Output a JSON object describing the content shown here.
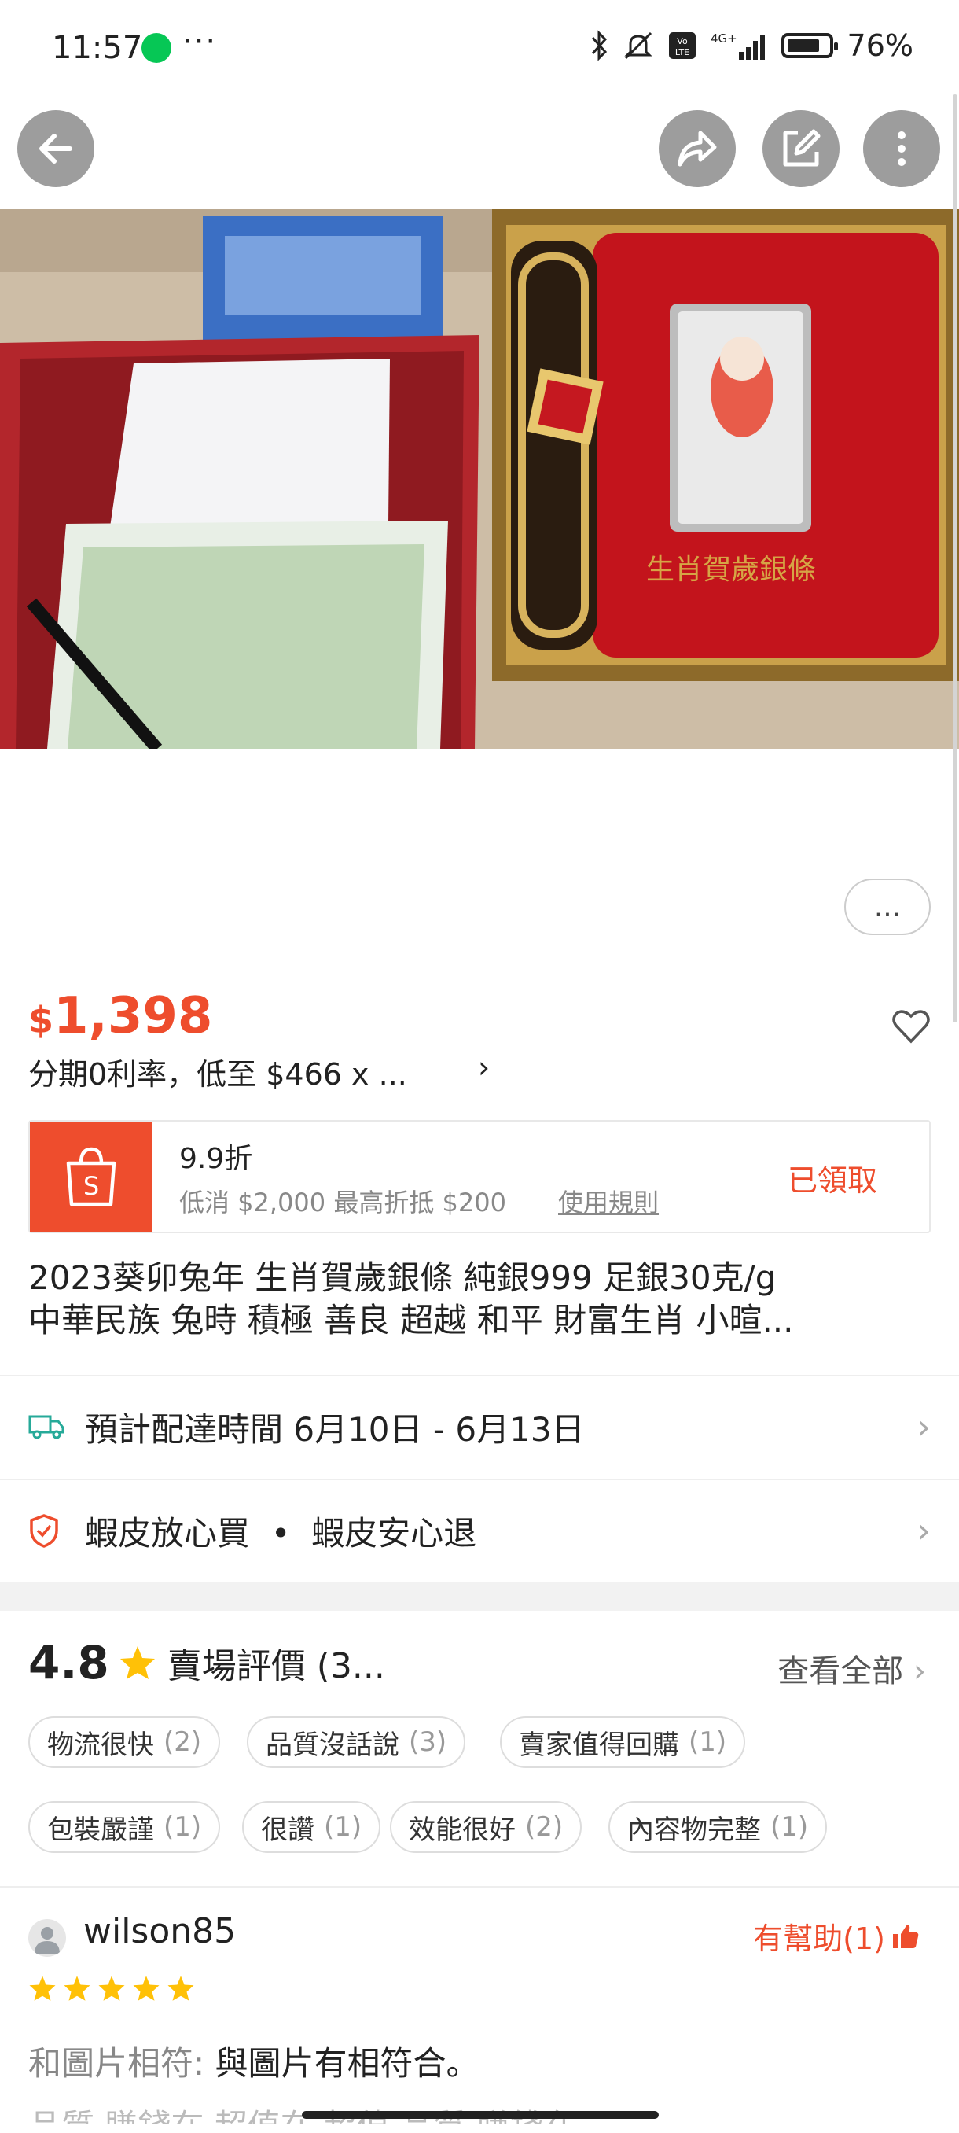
{
  "status_bar": {
    "time": "11:57",
    "more": "···",
    "battery": "76%",
    "icons": [
      "line-icon",
      "bluetooth-icon",
      "mute-icon",
      "volte-icon",
      "signal-icon",
      "battery-icon"
    ]
  },
  "nav": {
    "icons": [
      "back-arrow-icon",
      "share-icon",
      "edit-icon",
      "more-vertical-icon"
    ]
  },
  "product": {
    "gallery_more": "...",
    "price_currency": "$",
    "price_value": "1,398",
    "installment": "分期0利率，低至 $466 x ...",
    "installment_arrow": "›",
    "title_line1": "2023葵卯兔年 生肖賀歲銀條 純銀999 足銀30克/g",
    "title_line2": "中華民族 兔時 積極 善良 超越 和平 財富生肖 小暄..."
  },
  "voucher": {
    "title": "9.9折",
    "subtitle": "低消 $2,000 最高折抵 $200",
    "rule_link": "使用規則",
    "status": "已領取",
    "icon": "shopee-bag-icon"
  },
  "delivery": {
    "text": "預計配達時間 6月10日 - 6月13日",
    "icon": "truck-icon"
  },
  "guarantee": {
    "text": "蝦皮放心買  •  蝦皮安心退",
    "icon": "shield-check-icon"
  },
  "ratings": {
    "score": "4.8",
    "title": "賣場評價 (3...",
    "view_all": "查看全部",
    "tags": [
      {
        "label": "物流很快",
        "count": "(2)"
      },
      {
        "label": "品質沒話說",
        "count": "(3)"
      },
      {
        "label": "賣家值得回購",
        "count": "(1)"
      },
      {
        "label": "包裝嚴謹",
        "count": "(1)"
      },
      {
        "label": "很讚",
        "count": "(1)"
      },
      {
        "label": "效能很好",
        "count": "(2)"
      },
      {
        "label": "內容物完整",
        "count": "(1)"
      }
    ]
  },
  "review": {
    "username": "wilson85",
    "helpful": "有幫助(1)",
    "stars": 5,
    "label": "和圖片相符:",
    "text": " 與圖片有相符合。",
    "cut_text": "品質 賺錢在 超值在 超值 品質 賺錢在"
  },
  "colors": {
    "accent": "#ee4d2d",
    "star": "#ffc107"
  }
}
